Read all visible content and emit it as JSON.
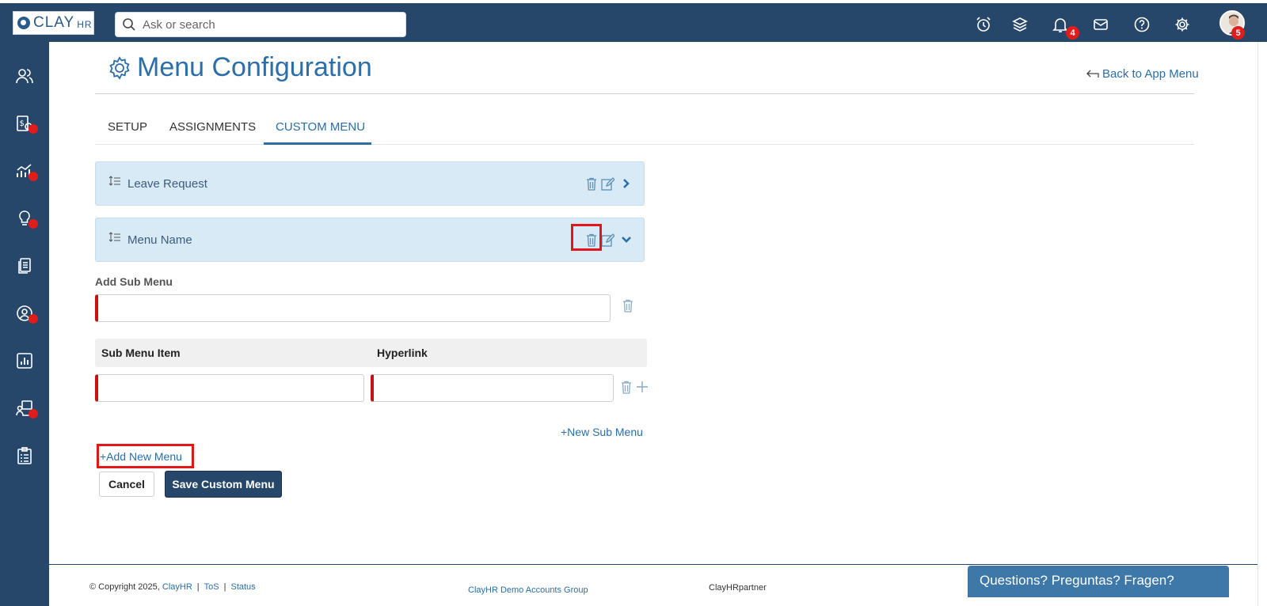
{
  "app": {
    "logo_text": "CLAY",
    "logo_suffix": "HR"
  },
  "search": {
    "placeholder": "Ask or search"
  },
  "topbar": {
    "icons": [
      "alarm-clock-icon",
      "layers-icon",
      "bell-icon",
      "envelope-icon",
      "help-icon",
      "gear-icon"
    ],
    "notification_count": "4",
    "avatar_badge": "5"
  },
  "sidebar": {
    "items": [
      {
        "icon": "people-icon",
        "dot": false
      },
      {
        "icon": "payroll-icon",
        "dot": true
      },
      {
        "icon": "analytics-icon",
        "dot": true
      },
      {
        "icon": "ideas-icon",
        "dot": true
      },
      {
        "icon": "documents-icon",
        "dot": false
      },
      {
        "icon": "profile-icon",
        "dot": true
      },
      {
        "icon": "reports-icon",
        "dot": false
      },
      {
        "icon": "training-icon",
        "dot": true
      },
      {
        "icon": "checklist-icon",
        "dot": false
      }
    ]
  },
  "page": {
    "title": "Menu Configuration",
    "back_link": "Back to App Menu"
  },
  "tabs": [
    {
      "label": "SETUP",
      "active": false
    },
    {
      "label": "ASSIGNMENTS",
      "active": false
    },
    {
      "label": "CUSTOM MENU",
      "active": true
    }
  ],
  "menus": [
    {
      "label": "Leave Request",
      "expanded": false
    },
    {
      "label": "Menu Name",
      "expanded": true
    }
  ],
  "submenu": {
    "add_label": "Add Sub Menu",
    "name_value": "",
    "col_item": "Sub Menu Item",
    "col_link": "Hyperlink",
    "item_value": "",
    "link_value": "",
    "new_sub_link": "+New Sub Menu"
  },
  "actions": {
    "add_menu": "+Add New Menu",
    "cancel": "Cancel",
    "save": "Save Custom Menu"
  },
  "footer": {
    "copyright": "© Copyright 2025,",
    "brand_link": "ClayHR",
    "tos": "ToS",
    "status": "Status",
    "group": "ClayHR Demo Accounts Group",
    "partner": "ClayHRpartner",
    "chat": "Questions? Preguntas? Fragen?"
  },
  "colors": {
    "nav": "#26476a",
    "accent": "#2b6ea8",
    "card": "#d8eaf5",
    "badge": "#e21b1b",
    "highlight": "#e0161b"
  }
}
